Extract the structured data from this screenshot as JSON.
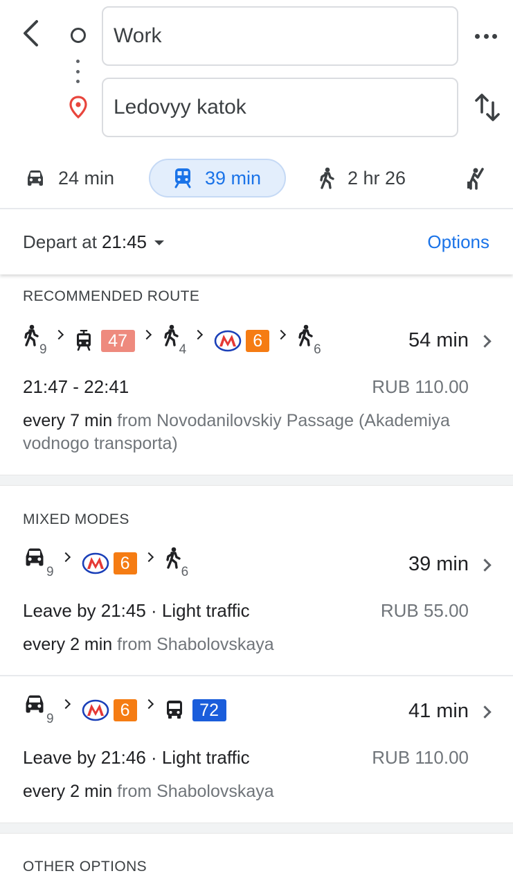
{
  "search": {
    "from_value": "Work",
    "to_value": "Ledovyy katok"
  },
  "modes": {
    "drive": "24 min",
    "transit": "39 min",
    "walk": "2 hr 26",
    "selected": "transit",
    "icons": [
      "car-icon",
      "train-icon",
      "walk-icon",
      "ride-hail-icon"
    ]
  },
  "depart": {
    "label": "Depart at",
    "time": "21:45",
    "options_label": "Options"
  },
  "colors": {
    "accent": "#1a73e8",
    "tram_badge": "#ee8a7e",
    "metro_badge": "#f57c13",
    "bus_badge": "#1a5ddb",
    "metro_logo": "#e53935"
  },
  "sections": {
    "recommended_title": "RECOMMENDED ROUTE",
    "mixed_title": "MIXED MODES",
    "other_title": "OTHER OPTIONS"
  },
  "routes": [
    {
      "steps": [
        {
          "type": "walk",
          "sub": "9"
        },
        {
          "type": "tram",
          "badge": "47"
        },
        {
          "type": "walk",
          "sub": "4"
        },
        {
          "type": "metro",
          "badge": "6"
        },
        {
          "type": "walk",
          "sub": "6"
        }
      ],
      "duration": "54 min",
      "times": "21:47 - 22:41",
      "price": "RUB 110.00",
      "freq": "every 7 min",
      "from": "from Novodanilovskiy Passage (Akademiya vodnogo transporta)"
    },
    {
      "steps": [
        {
          "type": "car",
          "sub": "9"
        },
        {
          "type": "metro",
          "badge": "6"
        },
        {
          "type": "walk",
          "sub": "6"
        }
      ],
      "duration": "39 min",
      "times": "Leave by 21:45 · Light traffic",
      "price": "RUB 55.00",
      "freq": "every 2 min",
      "from": "from Shabolovskaya"
    },
    {
      "steps": [
        {
          "type": "car",
          "sub": "9"
        },
        {
          "type": "metro",
          "badge": "6"
        },
        {
          "type": "bus",
          "badge": "72"
        }
      ],
      "duration": "41 min",
      "times": "Leave by 21:46 · Light traffic",
      "price": "RUB 110.00",
      "freq": "every 2 min",
      "from": "from Shabolovskaya"
    }
  ]
}
